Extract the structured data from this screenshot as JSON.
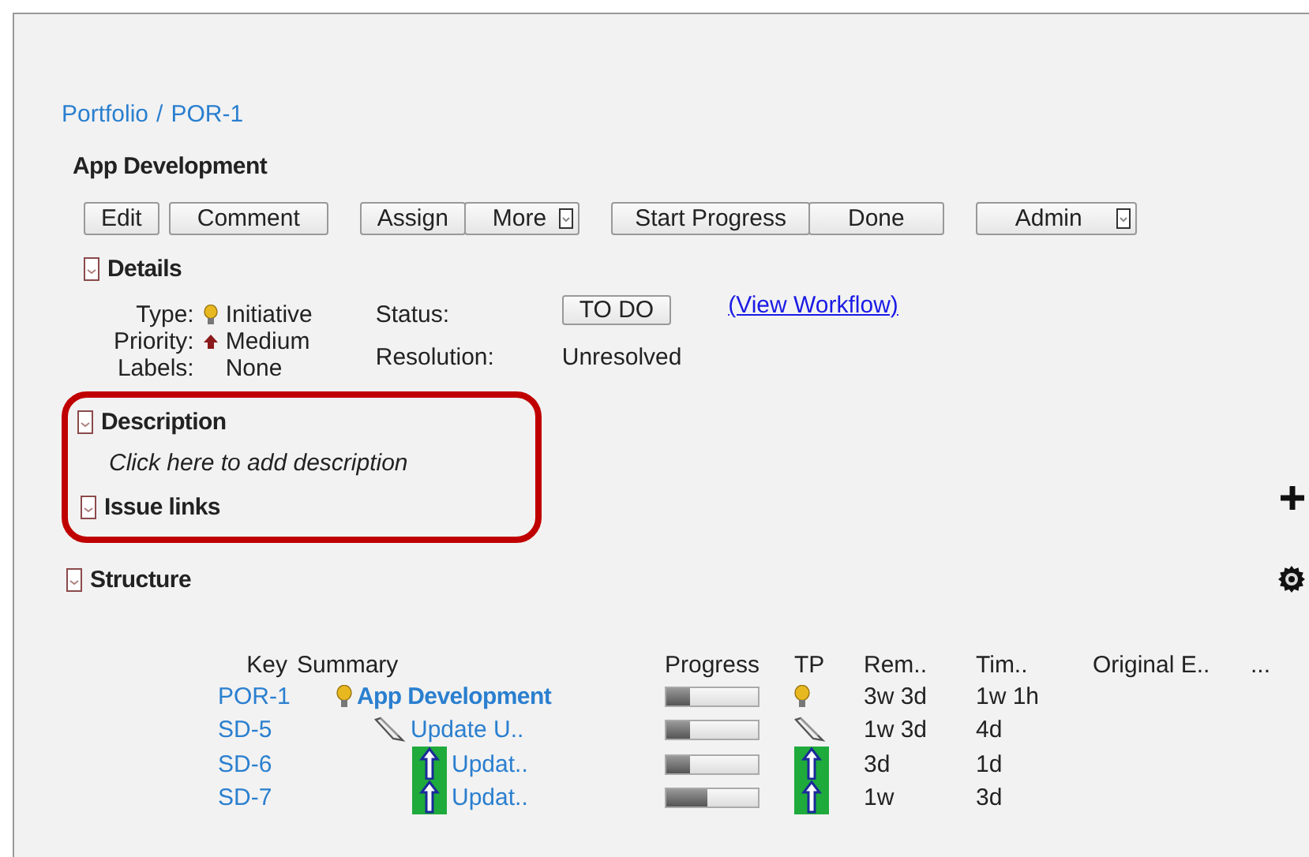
{
  "breadcrumb": {
    "separator": "/",
    "items": [
      {
        "label": "Portfolio"
      },
      {
        "label": "POR-1"
      }
    ]
  },
  "title": "App Development",
  "button_groups": [
    [
      {
        "label": "Edit",
        "dropdown": false
      }
    ],
    [
      {
        "label": "Comment",
        "dropdown": false
      }
    ],
    [
      {
        "label": "Assign",
        "dropdown": false
      },
      {
        "label": "More",
        "dropdown": true
      }
    ],
    [
      {
        "label": "Start Progress",
        "dropdown": false
      },
      {
        "label": "Done",
        "dropdown": false
      }
    ],
    [
      {
        "label": "Admin",
        "dropdown": true
      }
    ]
  ],
  "details": {
    "heading": "Details",
    "expanded": true,
    "fields": [
      {
        "label": "Type:",
        "value": "Initiative",
        "kind": "initiative"
      },
      {
        "label": "Priority:",
        "value": "Medium",
        "kind": "priority"
      },
      {
        "label": "Labels:",
        "value": "None"
      }
    ],
    "status_label": "Status:",
    "status": "TO DO",
    "workflow_link": "(View Workflow)",
    "resolution_label": "Resolution:",
    "resolution": "Unresolved"
  },
  "description": {
    "heading": "Description",
    "expanded": true,
    "placeholder": "Click here to add description"
  },
  "issue_links": {
    "heading": "Issue links",
    "expanded": true
  },
  "structure": {
    "heading": "Structure",
    "expanded": true,
    "columns": [
      "Key",
      "Summary",
      "Progress",
      "TP",
      "Rem..",
      "Tim..",
      "Original E..",
      "..."
    ],
    "rows": [
      {
        "key": "POR-1",
        "summary": "App Development",
        "kind": "initiative",
        "level": 0.25,
        "remaining": "3w 3d",
        "time_spent": "1w 1h",
        "children": [
          {
            "key": "SD-5",
            "summary": "Update U..",
            "kind": "epic",
            "level": 0.25,
            "remaining": "1w 3d",
            "time_spent": "4d",
            "children": [
              {
                "key": "SD-6",
                "summary": "Updat..",
                "kind": "story",
                "level": 0.25,
                "remaining": "3d",
                "time_spent": "1d"
              },
              {
                "key": "SD-7",
                "summary": "Updat..",
                "kind": "story",
                "level": 0.45,
                "remaining": "1w",
                "time_spent": "3d"
              }
            ]
          }
        ]
      }
    ]
  }
}
